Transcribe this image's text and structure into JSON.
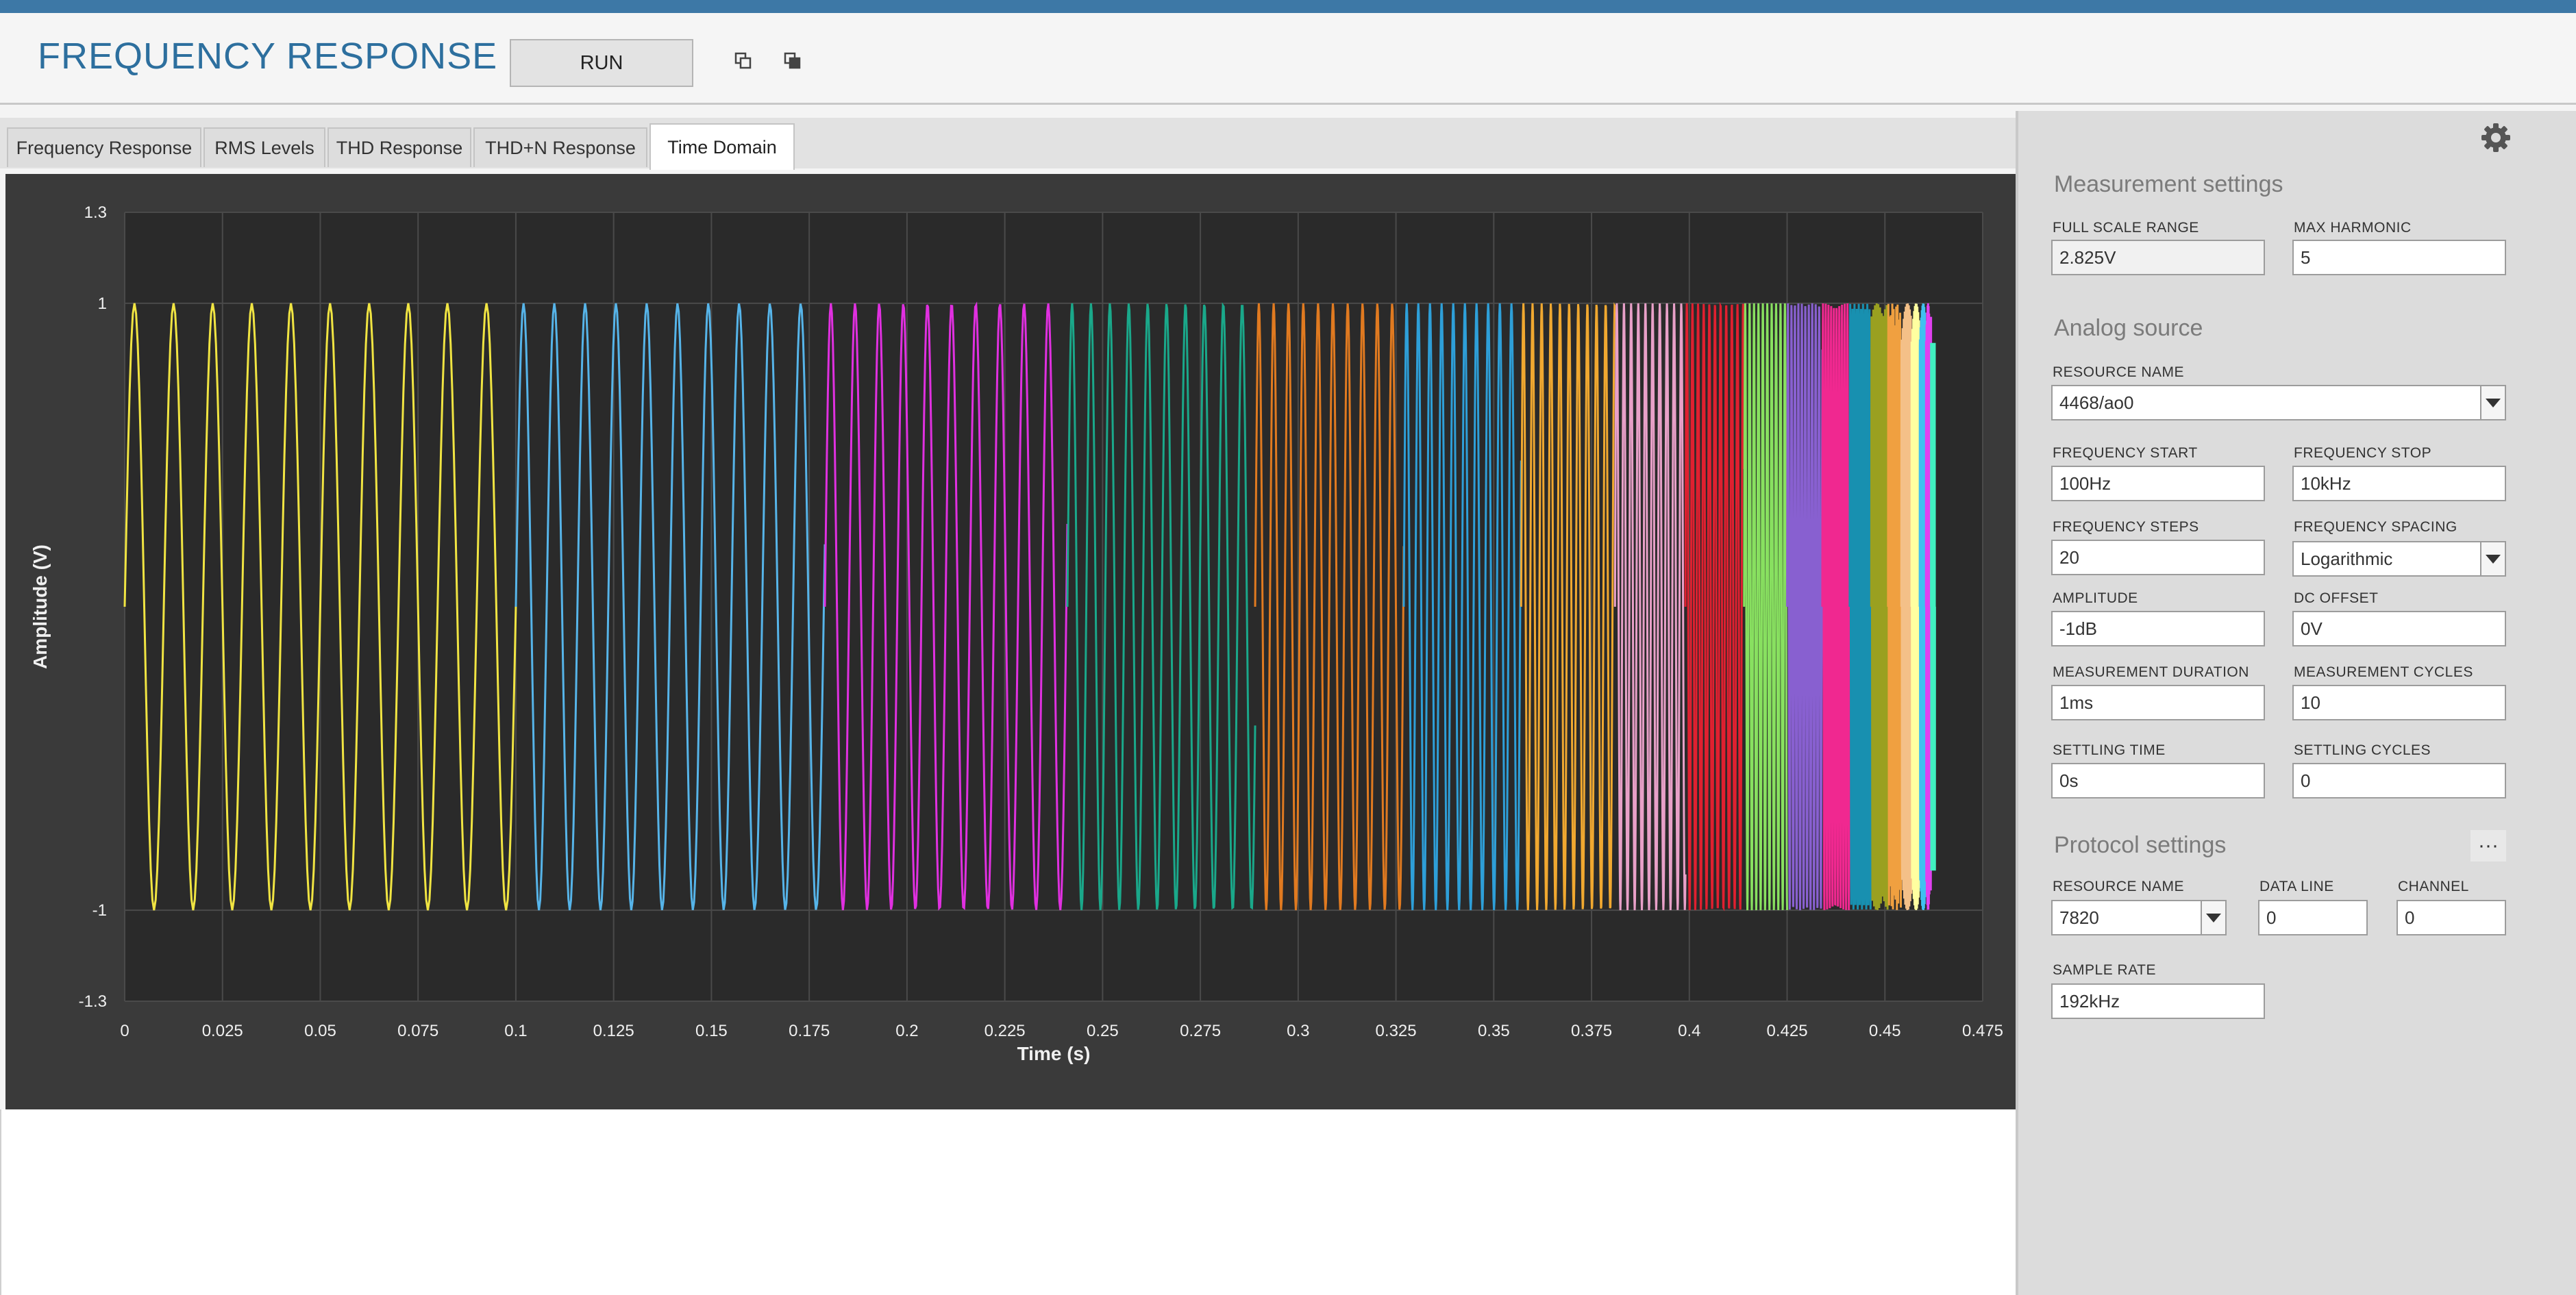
{
  "header": {
    "title": "FREQUENCY RESPONSE",
    "run_label": "RUN"
  },
  "tabs": [
    {
      "label": "Frequency Response",
      "active": false
    },
    {
      "label": "RMS Levels",
      "active": false
    },
    {
      "label": "THD Response",
      "active": false
    },
    {
      "label": "THD+N Response",
      "active": false
    },
    {
      "label": "Time Domain",
      "active": true
    }
  ],
  "chart_data": {
    "type": "line",
    "xlabel": "Time (s)",
    "ylabel": "Amplitude (V)",
    "xlim": [
      0,
      0.475
    ],
    "ylim": [
      -1.3,
      1.3
    ],
    "x_ticks": [
      "0",
      "0.025",
      "0.05",
      "0.075",
      "0.1",
      "0.125",
      "0.15",
      "0.175",
      "0.2",
      "0.225",
      "0.25",
      "0.275",
      "0.3",
      "0.325",
      "0.35",
      "0.375",
      "0.4",
      "0.425",
      "0.45",
      "0.475"
    ],
    "y_ticks": [
      "1.3",
      "1",
      "-1",
      "-1.3"
    ],
    "amplitude": 1.0,
    "grid": true,
    "background": "#2a2a2a",
    "series": [
      {
        "frequency_hz": 100,
        "t_start": 0.0,
        "t_end": 0.1,
        "color": "#f0e442"
      },
      {
        "frequency_hz": 127,
        "t_start": 0.1,
        "t_end": 0.179,
        "color": "#56b4e9"
      },
      {
        "frequency_hz": 162,
        "t_start": 0.179,
        "t_end": 0.241,
        "color": "#e030e0"
      },
      {
        "frequency_hz": 207,
        "t_start": 0.241,
        "t_end": 0.289,
        "color": "#1aa88a"
      },
      {
        "frequency_hz": 264,
        "t_start": 0.289,
        "t_end": 0.327,
        "color": "#e07a20"
      },
      {
        "frequency_hz": 336,
        "t_start": 0.327,
        "t_end": 0.357,
        "color": "#2e9fd8"
      },
      {
        "frequency_hz": 428,
        "t_start": 0.357,
        "t_end": 0.381,
        "color": "#f0a830"
      },
      {
        "frequency_hz": 546,
        "t_start": 0.381,
        "t_end": 0.399,
        "color": "#e8a0c8"
      },
      {
        "frequency_hz": 695,
        "t_start": 0.399,
        "t_end": 0.414,
        "color": "#e02030"
      },
      {
        "frequency_hz": 886,
        "t_start": 0.414,
        "t_end": 0.425,
        "color": "#88e060"
      },
      {
        "frequency_hz": 1129,
        "t_start": 0.425,
        "t_end": 0.434,
        "color": "#8860d0"
      },
      {
        "frequency_hz": 1438,
        "t_start": 0.434,
        "t_end": 0.441,
        "color": "#f02890"
      },
      {
        "frequency_hz": 1833,
        "t_start": 0.441,
        "t_end": 0.4465,
        "color": "#1890b0"
      },
      {
        "frequency_hz": 2336,
        "t_start": 0.4465,
        "t_end": 0.4508,
        "color": "#9aa020"
      },
      {
        "frequency_hz": 2976,
        "t_start": 0.4508,
        "t_end": 0.4542,
        "color": "#f0a040"
      },
      {
        "frequency_hz": 3793,
        "t_start": 0.4542,
        "t_end": 0.4568,
        "color": "#f4c088"
      },
      {
        "frequency_hz": 4833,
        "t_start": 0.4568,
        "t_end": 0.4589,
        "color": "#ffffa0"
      },
      {
        "frequency_hz": 6158,
        "t_start": 0.4589,
        "t_end": 0.4605,
        "color": "#40c0f0"
      },
      {
        "frequency_hz": 7848,
        "t_start": 0.4605,
        "t_end": 0.4618,
        "color": "#e040f0"
      },
      {
        "frequency_hz": 10000,
        "t_start": 0.4618,
        "t_end": 0.4628,
        "color": "#40f0c0"
      }
    ]
  },
  "settings": {
    "measurement": {
      "title": "Measurement settings",
      "full_scale_range_label": "FULL SCALE RANGE",
      "full_scale_range": "2.825V",
      "max_harmonic_label": "MAX HARMONIC",
      "max_harmonic": "5"
    },
    "analog": {
      "title": "Analog source",
      "resource_name_label": "RESOURCE NAME",
      "resource_name": "4468/ao0",
      "freq_start_label": "FREQUENCY START",
      "freq_start": "100Hz",
      "freq_stop_label": "FREQUENCY STOP",
      "freq_stop": "10kHz",
      "freq_steps_label": "FREQUENCY STEPS",
      "freq_steps": "20",
      "freq_spacing_label": "FREQUENCY SPACING",
      "freq_spacing": "Logarithmic",
      "amplitude_label": "AMPLITUDE",
      "amplitude": "-1dB",
      "dc_offset_label": "DC OFFSET",
      "dc_offset": "0V",
      "meas_duration_label": "MEASUREMENT DURATION",
      "meas_duration": "1ms",
      "meas_cycles_label": "MEASUREMENT CYCLES",
      "meas_cycles": "10",
      "settling_time_label": "SETTLING TIME",
      "settling_time": "0s",
      "settling_cycles_label": "SETTLING CYCLES",
      "settling_cycles": "0"
    },
    "protocol": {
      "title": "Protocol settings",
      "more_label": "···",
      "resource_name_label": "RESOURCE NAME",
      "resource_name": "7820",
      "data_line_label": "DATA LINE",
      "data_line": "0",
      "channel_label": "CHANNEL",
      "channel": "0",
      "sample_rate_label": "SAMPLE RATE",
      "sample_rate": "192kHz"
    }
  }
}
